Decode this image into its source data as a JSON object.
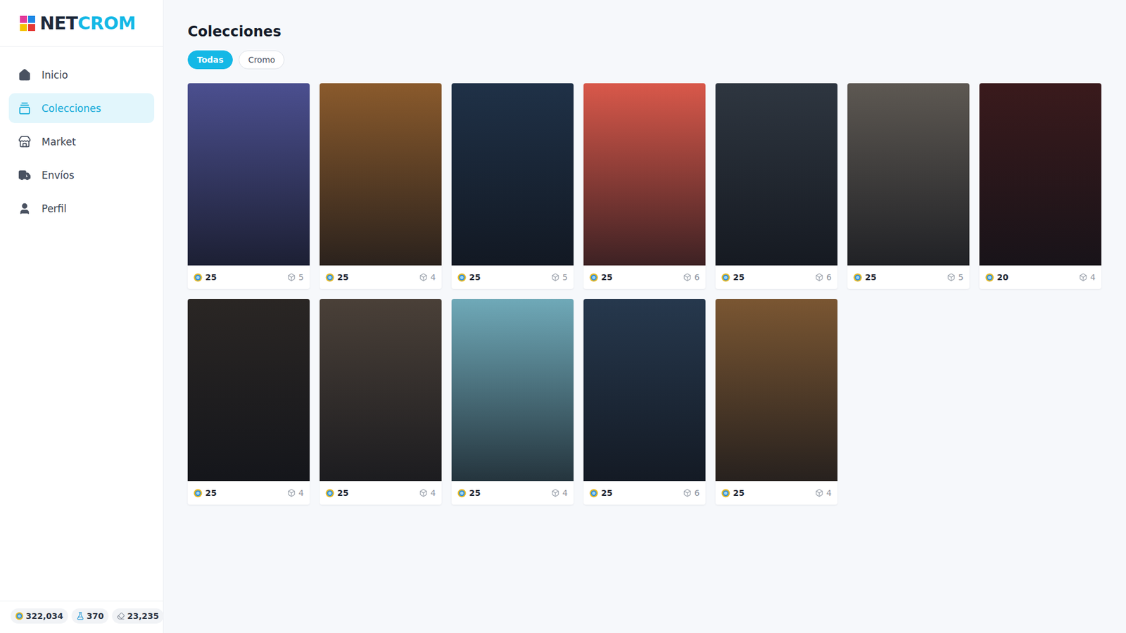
{
  "logo": {
    "dark": "NET",
    "accent": "CROM"
  },
  "sidebar": {
    "items": [
      {
        "label": "Inicio",
        "icon": "home",
        "selected": false
      },
      {
        "label": "Colecciones",
        "icon": "collections",
        "selected": true
      },
      {
        "label": "Market",
        "icon": "store",
        "selected": false
      },
      {
        "label": "Envíos",
        "icon": "truck",
        "selected": false
      },
      {
        "label": "Perfil",
        "icon": "user",
        "selected": false
      }
    ]
  },
  "status_bar": [
    {
      "value": "322,034",
      "icon": "coin"
    },
    {
      "value": "370",
      "icon": "bottle"
    },
    {
      "value": "23,235",
      "icon": "eraser"
    }
  ],
  "page": {
    "title": "Colecciones"
  },
  "filters": [
    {
      "label": "Todas",
      "selected": true
    },
    {
      "label": "Cromo",
      "selected": false
    }
  ],
  "collections": [
    {
      "price": "25",
      "count": "5",
      "color": "#4b4f8f"
    },
    {
      "price": "25",
      "count": "4",
      "color": "#8a5a2c"
    },
    {
      "price": "25",
      "count": "5",
      "color": "#1f3147"
    },
    {
      "price": "25",
      "count": "6",
      "color": "#d9584a"
    },
    {
      "price": "25",
      "count": "6",
      "color": "#2e3640"
    },
    {
      "price": "25",
      "count": "5",
      "color": "#5d5852"
    },
    {
      "price": "20",
      "count": "4",
      "color": "#3a1a1c"
    },
    {
      "price": "25",
      "count": "4",
      "color": "#2a2624"
    },
    {
      "price": "25",
      "count": "4",
      "color": "#4a4038"
    },
    {
      "price": "25",
      "count": "4",
      "color": "#6fa9b8"
    },
    {
      "price": "25",
      "count": "6",
      "color": "#26384d"
    },
    {
      "price": "25",
      "count": "4",
      "color": "#7a5632"
    }
  ]
}
